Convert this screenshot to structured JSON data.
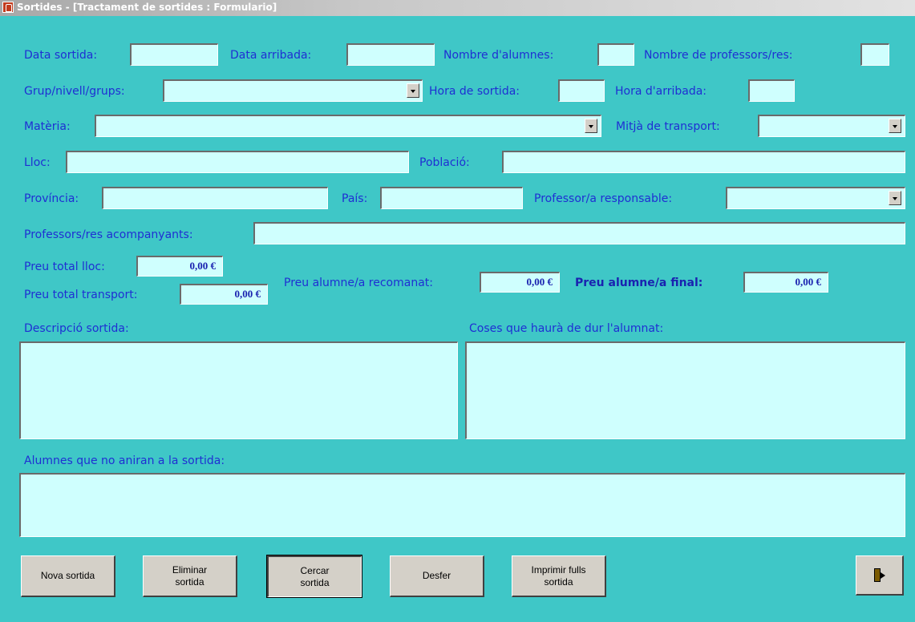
{
  "window": {
    "title": "Sortides - [Tractament de sortides : Formulario]",
    "icon": "access-form-icon"
  },
  "labels": {
    "data_sortida": "Data sortida:",
    "data_arribada": "Data arribada:",
    "nombre_alumnes": "Nombre d'alumnes:",
    "nombre_professors": "Nombre de professors/res:",
    "grup": "Grup/nivell/grups:",
    "hora_sortida": "Hora de sortida:",
    "hora_arribada": "Hora d'arribada:",
    "materia": "Matèria:",
    "mitja_transport": "Mitjà de transport:",
    "lloc": "Lloc:",
    "poblacio": "Població:",
    "provincia": "Província:",
    "pais": "País:",
    "professor_responsable": "Professor/a responsable:",
    "professors_acompanyants": "Professors/res acompanyants:",
    "preu_total_lloc": "Preu total lloc:",
    "preu_total_transport": "Preu total transport:",
    "preu_recomanat": "Preu alumne/a recomanat:",
    "preu_final": "Preu alumne/a final:",
    "descripcio": "Descripció sortida:",
    "coses": "Coses que haurà de dur l'alumnat:",
    "alumnes_no": "Alumnes que no aniran a la sortida:"
  },
  "values": {
    "preu_total_lloc": "0,00 €",
    "preu_total_transport": "0,00 €",
    "preu_recomanat": "0,00 €",
    "preu_final": "0,00 €"
  },
  "buttons": {
    "nova": "Nova sortida",
    "eliminar": "Eliminar\nsortida",
    "cercar": "Cercar\nsortida",
    "desfer": "Desfer",
    "imprimir": "Imprimir fulls\nsortida",
    "exit_icon": "exit-door-icon"
  },
  "colors": {
    "background": "#3fc7c7",
    "field": "#cffffe",
    "label": "#1f2fd3"
  }
}
